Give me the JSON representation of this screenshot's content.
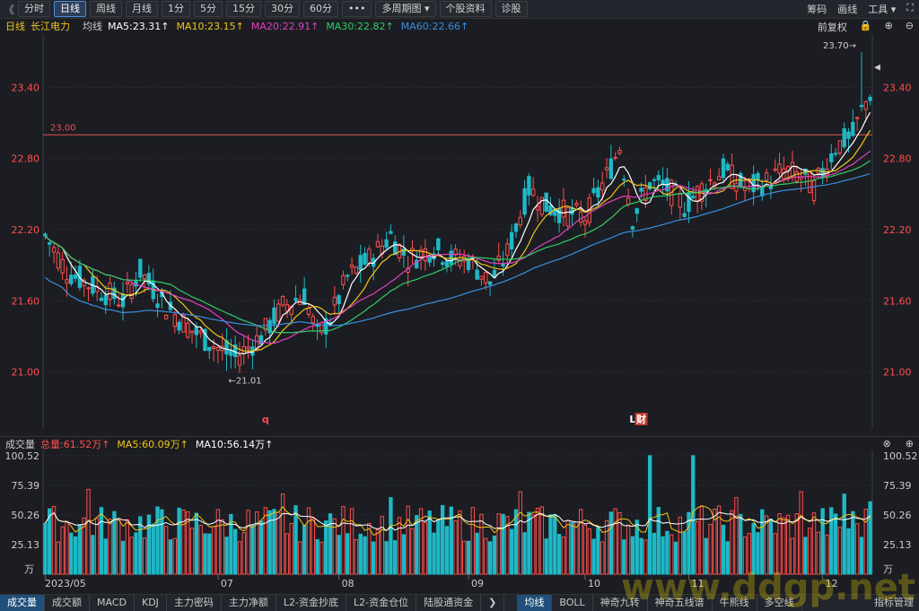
{
  "toolbar": {
    "back_glyph": "《",
    "tabs": [
      {
        "label": "分时"
      },
      {
        "label": "日线",
        "active": true
      },
      {
        "label": "周线"
      },
      {
        "label": "月线"
      },
      {
        "label": "1分"
      },
      {
        "label": "5分"
      },
      {
        "label": "15分"
      },
      {
        "label": "30分"
      },
      {
        "label": "60分"
      },
      {
        "label": "•••"
      },
      {
        "label": "多周期图 ▾"
      },
      {
        "label": "个股资料"
      },
      {
        "label": "诊股"
      }
    ],
    "right": [
      "筹码",
      "画线",
      "工具 ▾",
      "⛶"
    ]
  },
  "ma_bar": {
    "period": "日线",
    "stock": "长江电力",
    "avg": "均线",
    "items": [
      {
        "label": "MA5:23.31↑",
        "color": "#ffffff"
      },
      {
        "label": "MA10:23.15↑",
        "color": "#f0c419"
      },
      {
        "label": "MA20:22.91↑",
        "color": "#e040c0"
      },
      {
        "label": "MA30:22.82↑",
        "color": "#33cc66"
      },
      {
        "label": "MA60:22.66↑",
        "color": "#3a8fe0"
      }
    ],
    "right": [
      "前复权",
      "🔒",
      "⊕",
      "⊖"
    ]
  },
  "vol_bar": {
    "label": "成交量",
    "items": [
      {
        "label": "总量:61.52万↑",
        "color": "#ff4d4d"
      },
      {
        "label": "MA5:60.09万↑",
        "color": "#f0c419"
      },
      {
        "label": "MA10:56.14万↑",
        "color": "#ffffff"
      }
    ],
    "right": [
      "⊗",
      "⊕"
    ]
  },
  "bottom_tabs": {
    "left": [
      {
        "label": "成交量",
        "active": true
      },
      {
        "label": "成交额"
      },
      {
        "label": "MACD"
      },
      {
        "label": "KDJ"
      },
      {
        "label": "主力密码"
      },
      {
        "label": "主力净额"
      },
      {
        "label": "L2-资金抄底"
      },
      {
        "label": "L2-资金仓位"
      },
      {
        "label": "陆股通资金"
      },
      {
        "label": "❯"
      }
    ],
    "mid": [
      {
        "label": "均线",
        "active": true
      },
      {
        "label": "BOLL"
      },
      {
        "label": "神奇九转"
      },
      {
        "label": "神奇五线谱"
      },
      {
        "label": "牛熊线"
      },
      {
        "label": "多空线"
      }
    ],
    "right": "指标管理"
  },
  "watermark": "www.ddgp.net",
  "chart_data": [
    {
      "type": "candlestick",
      "title": "长江电力 日线",
      "y_ticks": [
        "23.40",
        "22.80",
        "22.20",
        "21.60",
        "21.00"
      ],
      "y_tick_values": [
        23.4,
        22.8,
        22.2,
        21.6,
        21.0
      ],
      "ylim": [
        20.52,
        23.85
      ],
      "x_ticks": [
        "2023/05",
        "07",
        "08",
        "09",
        "10",
        "11",
        "12"
      ],
      "x_tick_indices": [
        0,
        40,
        68,
        98,
        125,
        149,
        180
      ],
      "reference_line": {
        "value": 23.0,
        "label": "23.00",
        "color": "#e05555"
      },
      "annotations": [
        {
          "label": "23.70→",
          "value": 23.7,
          "index": 189,
          "kind": "high"
        },
        {
          "label": "←21.01",
          "value": 21.01,
          "index": 42,
          "kind": "low"
        },
        {
          "label": "q",
          "index": 51,
          "kind": "marker"
        },
        {
          "label": "L",
          "index": 136,
          "kind": "marker"
        },
        {
          "label": "财",
          "index": 138,
          "kind": "marker"
        }
      ],
      "ma_lines": [
        {
          "name": "MA5",
          "color": "#ffffff"
        },
        {
          "name": "MA10",
          "color": "#f0c419"
        },
        {
          "name": "MA20",
          "color": "#e040c0"
        },
        {
          "name": "MA30",
          "color": "#33cc66"
        },
        {
          "name": "MA60",
          "color": "#3a8fe0"
        }
      ],
      "anchors": [
        [
          0,
          22.15
        ],
        [
          5,
          21.85
        ],
        [
          12,
          21.7
        ],
        [
          18,
          21.6
        ],
        [
          22,
          21.85
        ],
        [
          28,
          21.55
        ],
        [
          34,
          21.35
        ],
        [
          40,
          21.2
        ],
        [
          44,
          21.12
        ],
        [
          50,
          21.3
        ],
        [
          55,
          21.55
        ],
        [
          60,
          21.65
        ],
        [
          63,
          21.3
        ],
        [
          66,
          21.45
        ],
        [
          70,
          21.8
        ],
        [
          75,
          21.95
        ],
        [
          80,
          22.15
        ],
        [
          84,
          21.95
        ],
        [
          90,
          22.05
        ],
        [
          94,
          21.95
        ],
        [
          98,
          21.95
        ],
        [
          103,
          21.75
        ],
        [
          107,
          22.0
        ],
        [
          112,
          22.55
        ],
        [
          116,
          22.4
        ],
        [
          120,
          22.35
        ],
        [
          125,
          22.3
        ],
        [
          130,
          22.65
        ],
        [
          133,
          22.9
        ],
        [
          136,
          22.3
        ],
        [
          140,
          22.6
        ],
        [
          144,
          22.55
        ],
        [
          148,
          22.4
        ],
        [
          152,
          22.55
        ],
        [
          157,
          22.7
        ],
        [
          162,
          22.55
        ],
        [
          167,
          22.6
        ],
        [
          171,
          22.7
        ],
        [
          175,
          22.65
        ],
        [
          178,
          22.55
        ],
        [
          183,
          22.9
        ],
        [
          187,
          23.0
        ],
        [
          189,
          23.2
        ],
        [
          191,
          23.35
        ]
      ],
      "count": 192
    },
    {
      "type": "bar",
      "title": "成交量",
      "unit": "万",
      "y_ticks": [
        "100.52",
        "75.39",
        "50.26",
        "25.13"
      ],
      "y_tick_values": [
        100.52,
        75.39,
        50.26,
        25.13
      ],
      "ylim": [
        0,
        105
      ],
      "tall_bars": [
        [
          10,
          72
        ],
        [
          55,
          68
        ],
        [
          80,
          65
        ],
        [
          110,
          70
        ],
        [
          140,
          100.52
        ],
        [
          150,
          100.52
        ],
        [
          160,
          65
        ],
        [
          175,
          70
        ],
        [
          185,
          68
        ],
        [
          191,
          61.52
        ]
      ],
      "base_level": 45
    }
  ]
}
